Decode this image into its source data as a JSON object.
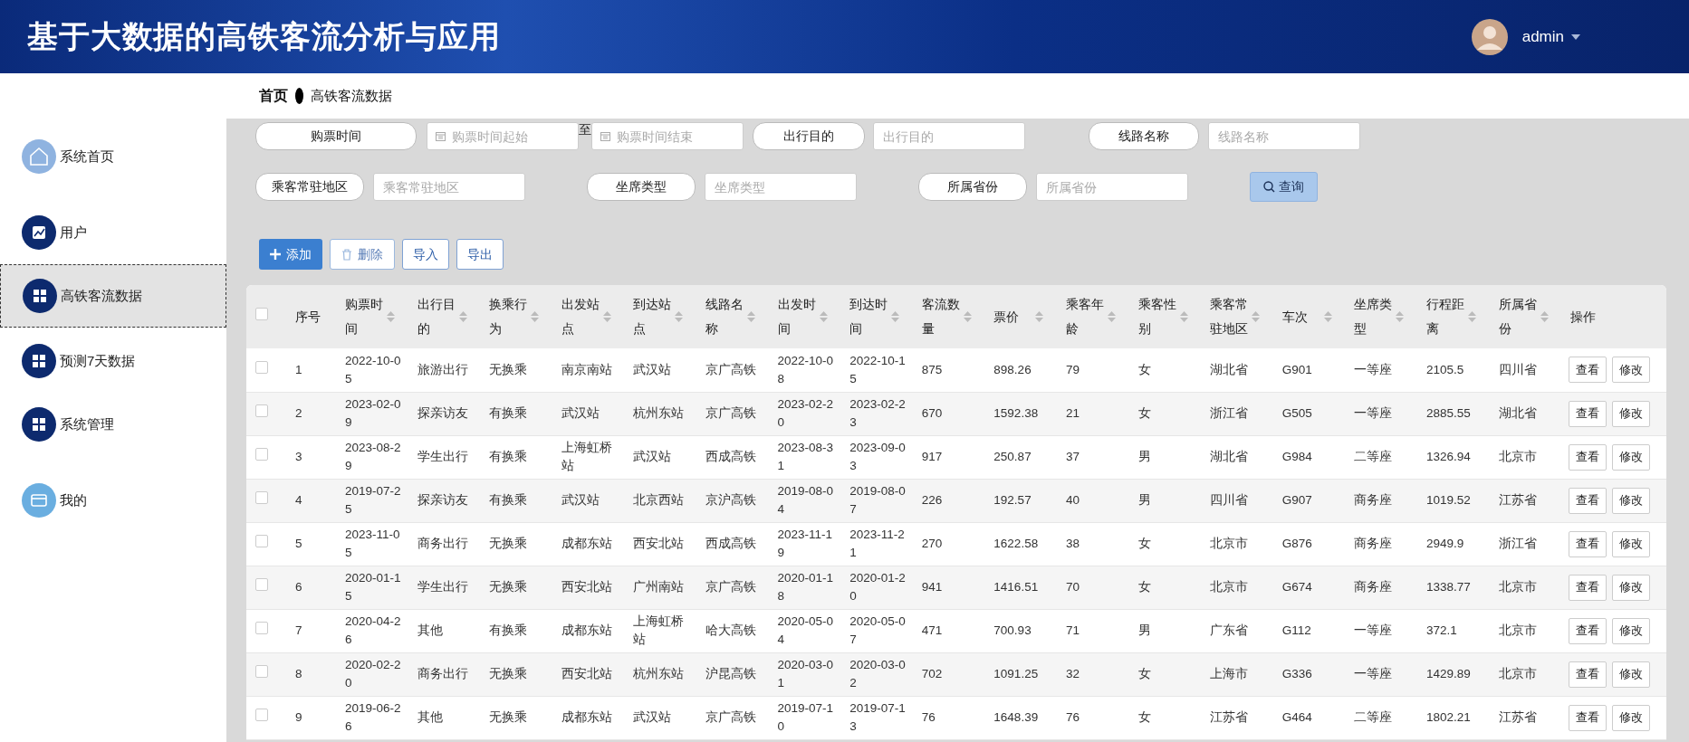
{
  "header": {
    "title": "基于大数据的高铁客流分析与应用",
    "user": "admin"
  },
  "sidebar": {
    "items": [
      {
        "label": "系统首页",
        "selected": false,
        "color": "#8fb3e0"
      },
      {
        "label": "用户",
        "selected": false,
        "color": "#0d2a6e"
      },
      {
        "label": "高铁客流数据",
        "selected": true,
        "color": "#0d2a6e"
      },
      {
        "label": "预测7天数据",
        "selected": false,
        "color": "#0d2a6e"
      },
      {
        "label": "系统管理",
        "selected": false,
        "color": "#0d2a6e"
      },
      {
        "label": "我的",
        "selected": false,
        "color": "#6aaee0"
      }
    ]
  },
  "breadcrumb": [
    "首页",
    "高铁客流数据"
  ],
  "filters": {
    "row1": [
      {
        "kind": "label",
        "text": "购票时间"
      },
      {
        "kind": "date",
        "placeholder": "购票时间起始"
      },
      {
        "kind": "sep",
        "text": "至"
      },
      {
        "kind": "date",
        "placeholder": "购票时间结束"
      },
      {
        "kind": "label",
        "text": "出行目的"
      },
      {
        "kind": "input",
        "placeholder": "出行目的"
      },
      {
        "kind": "label",
        "text": "线路名称"
      },
      {
        "kind": "input",
        "placeholder": "线路名称"
      }
    ],
    "row2": [
      {
        "kind": "label",
        "text": "乘客常驻地区"
      },
      {
        "kind": "input",
        "placeholder": "乘客常驻地区"
      },
      {
        "kind": "label",
        "text": "坐席类型"
      },
      {
        "kind": "input",
        "placeholder": "坐席类型"
      },
      {
        "kind": "label",
        "text": "所属省份"
      },
      {
        "kind": "input",
        "placeholder": "所属省份"
      },
      {
        "kind": "search",
        "text": "查询"
      }
    ]
  },
  "actions": [
    {
      "kind": "add",
      "text": "添加"
    },
    {
      "kind": "delete",
      "text": "删除"
    },
    {
      "kind": "plain",
      "text": "导入"
    },
    {
      "kind": "plain",
      "text": "导出"
    }
  ],
  "table": {
    "select_all_checked": false,
    "columns": [
      {
        "label": "序号",
        "sortable": false
      },
      {
        "label": "购票时间",
        "sortable": true
      },
      {
        "label": "出行目的",
        "sortable": true
      },
      {
        "label": "换乘行为",
        "sortable": true
      },
      {
        "label": "出发站点",
        "sortable": true
      },
      {
        "label": "到达站点",
        "sortable": true
      },
      {
        "label": "线路名称",
        "sortable": true
      },
      {
        "label": "出发时间",
        "sortable": true
      },
      {
        "label": "到达时间",
        "sortable": true
      },
      {
        "label": "客流数量",
        "sortable": true
      },
      {
        "label": "票价",
        "sortable": true
      },
      {
        "label": "乘客年龄",
        "sortable": true
      },
      {
        "label": "乘客性别",
        "sortable": true
      },
      {
        "label": "乘客常驻地区",
        "sortable": true
      },
      {
        "label": "车次",
        "sortable": true
      },
      {
        "label": "坐席类型",
        "sortable": true
      },
      {
        "label": "行程距离",
        "sortable": true
      },
      {
        "label": "所属省份",
        "sortable": true
      },
      {
        "label": "操作",
        "sortable": false
      }
    ],
    "rows": [
      {
        "checked": false,
        "cells": [
          "1",
          "2022-10-05",
          "旅游出行",
          "无换乘",
          "南京南站",
          "武汉站",
          "京广高铁",
          "2022-10-08",
          "2022-10-15",
          "875",
          "898.26",
          "79",
          "女",
          "湖北省",
          "G901",
          "一等座",
          "2105.5",
          "四川省"
        ],
        "buttons": [
          "查看",
          "修改"
        ]
      },
      {
        "checked": false,
        "cells": [
          "2",
          "2023-02-09",
          "探亲访友",
          "有换乘",
          "武汉站",
          "杭州东站",
          "京广高铁",
          "2023-02-20",
          "2023-02-23",
          "670",
          "1592.38",
          "21",
          "女",
          "浙江省",
          "G505",
          "一等座",
          "2885.55",
          "湖北省"
        ],
        "buttons": [
          "查看",
          "修改"
        ]
      },
      {
        "checked": false,
        "cells": [
          "3",
          "2023-08-29",
          "学生出行",
          "有换乘",
          "上海虹桥站",
          "武汉站",
          "西成高铁",
          "2023-08-31",
          "2023-09-03",
          "917",
          "250.87",
          "37",
          "男",
          "湖北省",
          "G984",
          "二等座",
          "1326.94",
          "北京市"
        ],
        "buttons": [
          "查看",
          "修改"
        ]
      },
      {
        "checked": false,
        "cells": [
          "4",
          "2019-07-25",
          "探亲访友",
          "有换乘",
          "武汉站",
          "北京西站",
          "京沪高铁",
          "2019-08-04",
          "2019-08-07",
          "226",
          "192.57",
          "40",
          "男",
          "四川省",
          "G907",
          "商务座",
          "1019.52",
          "江苏省"
        ],
        "buttons": [
          "查看",
          "修改"
        ]
      },
      {
        "checked": false,
        "cells": [
          "5",
          "2023-11-05",
          "商务出行",
          "无换乘",
          "成都东站",
          "西安北站",
          "西成高铁",
          "2023-11-19",
          "2023-11-21",
          "270",
          "1622.58",
          "38",
          "女",
          "北京市",
          "G876",
          "商务座",
          "2949.9",
          "浙江省"
        ],
        "buttons": [
          "查看",
          "修改"
        ]
      },
      {
        "checked": false,
        "cells": [
          "6",
          "2020-01-15",
          "学生出行",
          "无换乘",
          "西安北站",
          "广州南站",
          "京广高铁",
          "2020-01-18",
          "2020-01-20",
          "941",
          "1416.51",
          "70",
          "女",
          "北京市",
          "G674",
          "商务座",
          "1338.77",
          "北京市"
        ],
        "buttons": [
          "查看",
          "修改"
        ]
      },
      {
        "checked": false,
        "cells": [
          "7",
          "2020-04-26",
          "其他",
          "有换乘",
          "成都东站",
          "上海虹桥站",
          "哈大高铁",
          "2020-05-04",
          "2020-05-07",
          "471",
          "700.93",
          "71",
          "男",
          "广东省",
          "G112",
          "一等座",
          "372.1",
          "北京市"
        ],
        "buttons": [
          "查看",
          "修改"
        ]
      },
      {
        "checked": false,
        "cells": [
          "8",
          "2020-02-20",
          "商务出行",
          "无换乘",
          "西安北站",
          "杭州东站",
          "沪昆高铁",
          "2020-03-01",
          "2020-03-02",
          "702",
          "1091.25",
          "32",
          "女",
          "上海市",
          "G336",
          "一等座",
          "1429.89",
          "北京市"
        ],
        "buttons": [
          "查看",
          "修改"
        ]
      },
      {
        "checked": false,
        "cells": [
          "9",
          "2019-06-26",
          "其他",
          "无换乘",
          "成都东站",
          "武汉站",
          "京广高铁",
          "2019-07-10",
          "2019-07-13",
          "76",
          "1648.39",
          "76",
          "女",
          "江苏省",
          "G464",
          "二等座",
          "1802.21",
          "江苏省"
        ],
        "buttons": [
          "查看",
          "修改"
        ]
      }
    ]
  }
}
